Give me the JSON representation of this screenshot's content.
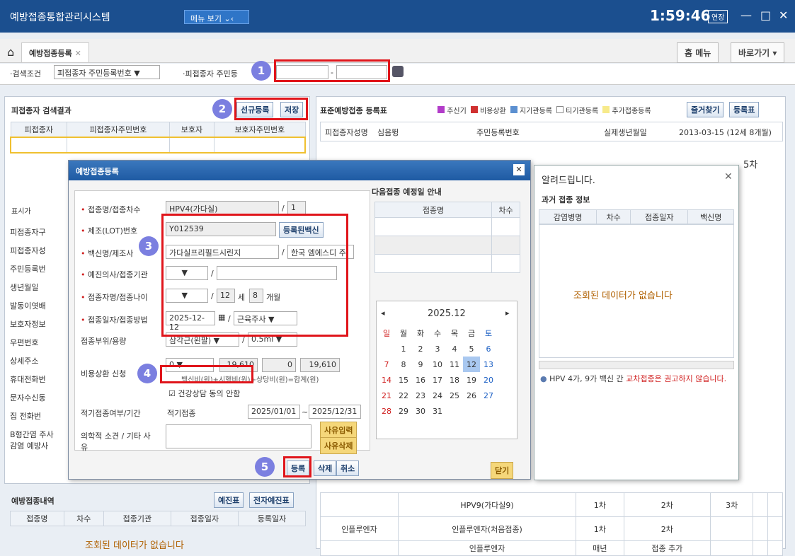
{
  "titlebar": {
    "app": "예방접종통합관리시스템",
    "menu": "메뉴 보기",
    "clock": "1:59:46",
    "extend": "연장",
    "min": "—",
    "max": "□",
    "close": "✕"
  },
  "tabbar": {
    "home": "⌂",
    "tab": "예방접종등록",
    "tab_close": "✕",
    "home_menu": "홈 메뉴",
    "shortcut": "바로가기 ▾"
  },
  "search": {
    "cond_label": "·검색조건",
    "cond_value": "피접종자 주민등록번호",
    "rrn_label": "·피접종자 주민등",
    "sep": "-"
  },
  "left": {
    "title": "피접종자 검색결과",
    "new_btn": "선규등록",
    "save_btn": "저장",
    "cols": [
      "피접종자",
      "피접종자주민번호",
      "보호자",
      "보호자주민번호"
    ],
    "side_labels": [
      "피접종자구",
      "피접종자성",
      "주민등록번",
      "생년월일",
      "발동이엿배",
      "보호자정보",
      "우편번호",
      "상세주소",
      "휴대전화번",
      "문자수신동",
      "집 전화번",
      "B형간염 주사",
      "감염 예방사"
    ],
    "marker": "표시가",
    "history_title": "예방접종내역",
    "btn1": "예진표",
    "btn2": "전자예진표",
    "hist_cols": [
      "접종명",
      "차수",
      "접종기관",
      "접종일자",
      "등록일자"
    ],
    "empty": "조회된 데이터가 없습니다"
  },
  "right": {
    "title": "표준예방접종 등록표",
    "legend": [
      "주신기",
      "비용상환",
      "지기관등록",
      "티기관등록",
      "추가접종등록"
    ],
    "btn_find": "즐거찾기",
    "btn_reg": "등록표",
    "name_label": "피접종자성명",
    "name": "심음뜅",
    "rrn_label": "주민등록번호",
    "birth_label": "실제생년월일",
    "birth": "2013-03-15 (12세 8개월)",
    "rows": [
      {
        "c1": "",
        "c2": "HPV9(가다실9)",
        "c3": "1차",
        "c4": "2차",
        "c5": "3차"
      },
      {
        "c1": "인플루엔자",
        "c2": "인플루엔자(처음접종)",
        "c3": "1차",
        "c4": "2차",
        "c5": ""
      },
      {
        "c1": "",
        "c2": "인플루엔자",
        "c3": "매년",
        "c4": "접종 추가",
        "c5": ""
      }
    ],
    "col_header": "5차"
  },
  "modal": {
    "title": "예방접종등록",
    "close": "✕",
    "f1_label": "접종명/접종차수",
    "f1_value": "HPV4(가다실)",
    "f1_num": "1",
    "f2_label": "제조(LOT)번호",
    "f2_value": "Y012539",
    "f2_btn": "등록된백신",
    "f3_label": "백신명/제조사",
    "f3_value": "가다실프리필드시린지",
    "f3_maker": "한국 엠에스디 주",
    "f4_label": "예진의사/접종기관",
    "f5_label": "접종자명/접종나이",
    "f5_age": "12",
    "f5_years": "세",
    "f5_months": "8",
    "f5_mlabel": "개월",
    "f6_label": "접종일자/접종방법",
    "f6_date": "2025-12-12",
    "f6_method": "근육주사",
    "f7_label": "접종부위/용량",
    "f7_site": "삼각근(왼팔)",
    "f7_dose": "0.5ml",
    "f8_label": "비용상환 신청",
    "f8_v1": "0",
    "f8_v2": "19,610",
    "f8_v3": "0",
    "f8_v4": "19,610",
    "f8_formula": "백신비(원)+시행비(원)+상당비(원)=합계(원)",
    "f8_check": "건강상담 동의 안함",
    "f9_label": "적기접종여부/기간",
    "f9_value": "적기접종",
    "f9_from": "2025/01/01",
    "f9_to": "2025/12/31",
    "f10_label": "의학적 소견 / 기타 사유",
    "btn_reason": "사유입력",
    "btn_del_reason": "사유삭제",
    "btn_reg": "등록",
    "btn_del": "삭제",
    "btn_cancel": "취소",
    "btn_close": "닫기",
    "next_title": "다음접종 예정일 안내",
    "next_cols": [
      "접종명",
      "차수"
    ],
    "cal_month": "2025.12",
    "cal_days": [
      "일",
      "월",
      "화",
      "수",
      "목",
      "금",
      "토"
    ],
    "cal_weeks": [
      [
        "",
        "1",
        "2",
        "3",
        "4",
        "5",
        "6"
      ],
      [
        "7",
        "8",
        "9",
        "10",
        "11",
        "12",
        "13"
      ],
      [
        "14",
        "15",
        "16",
        "17",
        "18",
        "19",
        "20"
      ],
      [
        "21",
        "22",
        "23",
        "24",
        "25",
        "26",
        "27"
      ],
      [
        "28",
        "29",
        "30",
        "31",
        "",
        "",
        ""
      ]
    ]
  },
  "alert": {
    "title": "알려드립니다.",
    "close": "✕",
    "sub": "과거 접종 정보",
    "cols": [
      "감염병명",
      "차수",
      "접종일자",
      "백신명"
    ],
    "empty": "조회된 데이터가 없습니다",
    "note_pre": "HPV 4가, 9가 백신 간 ",
    "note_red": "교차접종은 권고하지 않습니다."
  },
  "annotations": [
    "1",
    "2",
    "3",
    "4",
    "5"
  ]
}
